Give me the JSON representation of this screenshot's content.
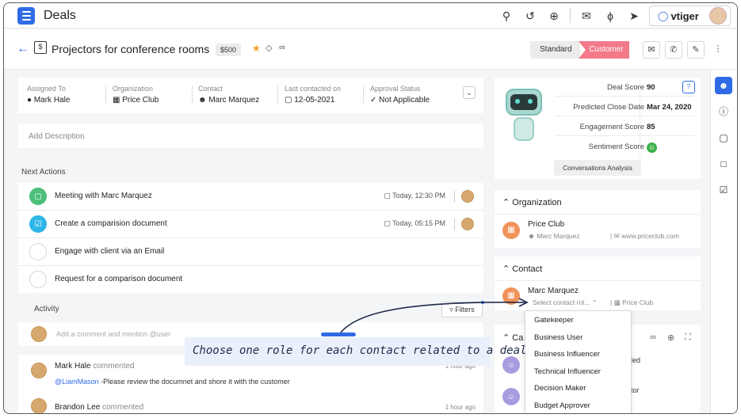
{
  "app": {
    "title": "Deals",
    "brand": "vtiger"
  },
  "header": {
    "title": "Projectors for conference rooms",
    "amount": "$500",
    "type_standard": "Standard",
    "type_customer": "Customer"
  },
  "summary": {
    "fields": [
      {
        "label": "Assigned To",
        "value": "Mark Hale"
      },
      {
        "label": "Organization",
        "value": "Price Club"
      },
      {
        "label": "Contact",
        "value": "Marc Marquez"
      },
      {
        "label": "Last contacted on",
        "value": "12-05-2021"
      },
      {
        "label": "Approval Status",
        "value": "Not Applicable"
      }
    ]
  },
  "description": {
    "placeholder": "Add Description"
  },
  "next_actions": {
    "title": "Next Actions",
    "items": [
      {
        "label": "Meeting with Marc Marquez",
        "time": "Today, 12:30 PM"
      },
      {
        "label": "Create a comparision document",
        "time": "Today, 05:15 PM"
      },
      {
        "label": "Engage with client via an Email"
      },
      {
        "label": "Request for a comparison document"
      }
    ]
  },
  "activity": {
    "title": "Activity",
    "filters_label": "Filters",
    "comment_placeholder": "Add a comment and mention @user",
    "feed": [
      {
        "name": "Mark Hale",
        "verb": "commented",
        "mention": "@LiamMason",
        "text": " -Please review the documnet and shore it with the customer",
        "ago": "1 hour ago"
      },
      {
        "name": "Brandon Lee",
        "verb": "commented",
        "ago": "1 hour ago"
      }
    ]
  },
  "insights": {
    "scores": [
      {
        "label": "Deal Score",
        "value": "90"
      },
      {
        "label": "Predicted Close Date",
        "value": "Mar 24, 2020"
      },
      {
        "label": "Engagement Score",
        "value": "85"
      },
      {
        "label": "Sentiment Score",
        "value": ""
      }
    ],
    "conversations_label": "Conversations Analysis"
  },
  "organization": {
    "heading": "Organization",
    "name": "Price Club",
    "contact": "Marc Marquez",
    "website": "www.priceclub.com"
  },
  "contact": {
    "heading": "Contact",
    "name": "Marc Marquez",
    "role_placeholder": "Select contact rol...",
    "org": "Price Club"
  },
  "cases": {
    "heading": "Ca",
    "side_1": "led",
    "side_2": "tor"
  },
  "role_dropdown": {
    "options": [
      "Gatekeeper",
      "Business User",
      "Business Influencer",
      "Technical Influencer",
      "Decision Maker",
      "Budget Approver"
    ]
  },
  "callout": {
    "text": "Choose one role for each contact related to a deal"
  },
  "colors": {
    "accent": "#2f6be6",
    "customer": "#f27a8a",
    "org_icon": "#f0935a"
  }
}
